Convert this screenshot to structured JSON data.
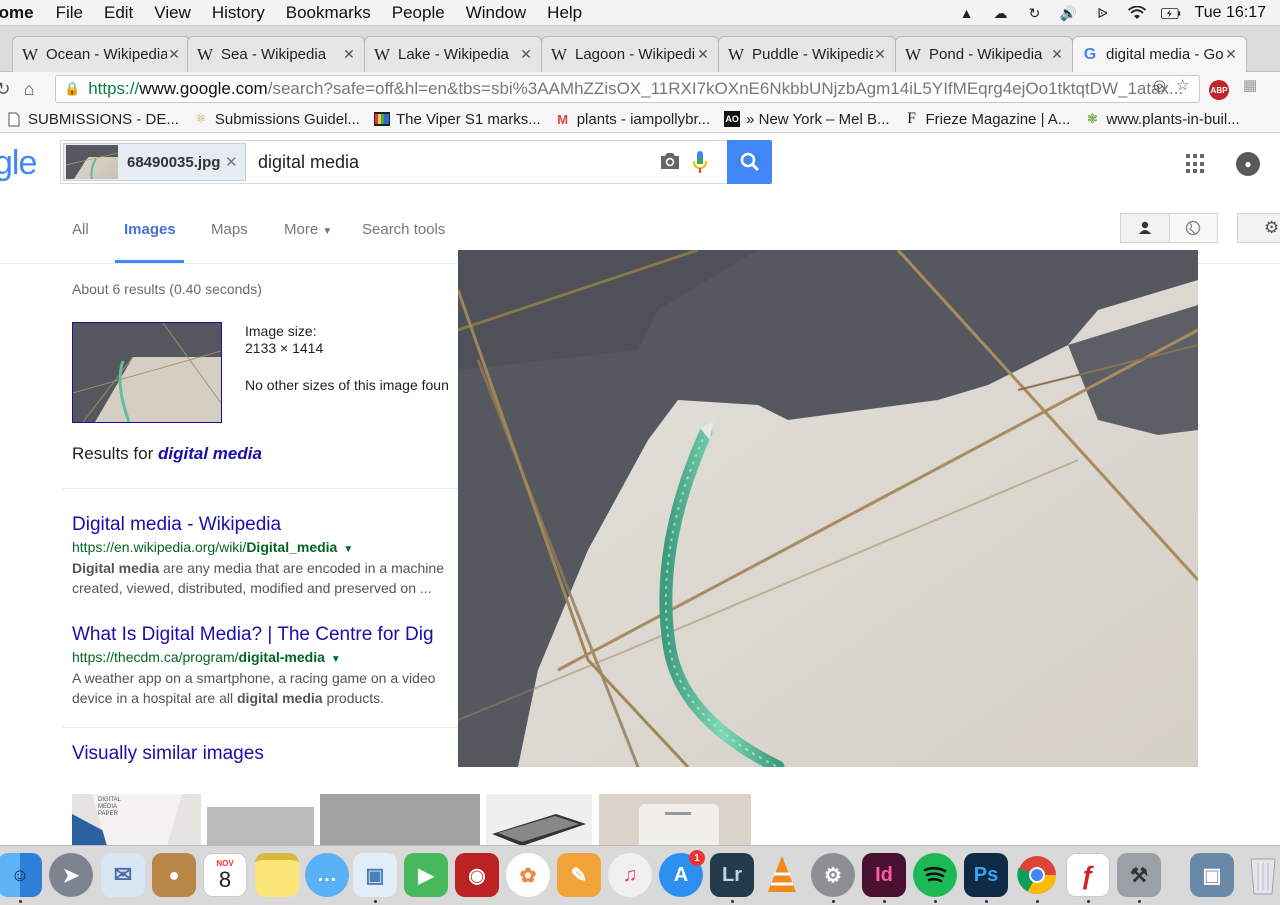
{
  "menubar": {
    "app_name": "rome",
    "menus": [
      "File",
      "Edit",
      "View",
      "History",
      "Bookmarks",
      "People",
      "Window",
      "Help"
    ],
    "clock": "Tue 16:17"
  },
  "tabs": [
    {
      "label": "Ocean - Wikipedia",
      "favicon": "W"
    },
    {
      "label": "Sea - Wikipedia",
      "favicon": "W"
    },
    {
      "label": "Lake - Wikipedia",
      "favicon": "W"
    },
    {
      "label": "Lagoon - Wikipedia",
      "favicon": "W"
    },
    {
      "label": "Puddle - Wikipedia",
      "favicon": "W"
    },
    {
      "label": "Pond - Wikipedia",
      "favicon": "W"
    },
    {
      "label": "digital media - Google",
      "favicon": "G"
    }
  ],
  "omnibox": {
    "scheme": "https://",
    "host": "www.google.com",
    "rest": "/search?safe=off&hl=en&tbs=sbi%3AAMhZZisOX_11RXI7kOXnE6NkbbUNjzbAgm14iL5YIfMEqrg4ejOo1tktqtDW_1atax..."
  },
  "bookmarks": [
    {
      "label": "SUBMISSIONS - DE...",
      "icon": "page-icon"
    },
    {
      "label": "Submissions Guidel...",
      "icon": "submittable-icon"
    },
    {
      "label": "The Viper S1 marks...",
      "icon": "viper-icon"
    },
    {
      "label": "plants - iampollybr...",
      "icon": "gmail-icon"
    },
    {
      "label": "» New York – Mel B...",
      "icon": "ao-icon"
    },
    {
      "label": "Frieze Magazine | A...",
      "icon": "frieze-icon"
    },
    {
      "label": "www.plants-in-buil...",
      "icon": "plant-icon"
    }
  ],
  "search": {
    "logo_fragment": "gle",
    "image_chip": "68490035.jpg",
    "query": "digital media"
  },
  "nav": {
    "tabs": [
      "All",
      "Images",
      "Maps",
      "More",
      "Search tools"
    ],
    "active": "Images"
  },
  "results": {
    "stats": "About 6 results (0.40 seconds)",
    "image_size_label": "Image size:",
    "image_size_value": "2133 × 1414",
    "no_other_sizes": "No other sizes of this image foun",
    "results_for_prefix": "Results for ",
    "results_for_query": "digital media",
    "items": [
      {
        "title": "Digital media - Wikipedia",
        "url_prefix": "https://en.wikipedia.org/wiki/",
        "url_bold": "Digital_media",
        "snippet_line1_bold": "Digital media",
        "snippet_line1_rest": " are any media that are encoded in a machine",
        "snippet_line2": "created, viewed, distributed, modified and preserved on ..."
      },
      {
        "title": "What Is Digital Media? | The Centre for Dig",
        "url_prefix": "https://thecdm.ca/program/",
        "url_bold": "digital-media",
        "snippet_line1": "A weather app on a smartphone, a racing game on a video",
        "snippet_line2_pre": "device in a hospital are all ",
        "snippet_line2_bold": "digital media",
        "snippet_line2_post": " products."
      }
    ],
    "visually_similar": "Visually similar images"
  },
  "similar_thumb_text": "DIGITAL MEDIA PAPER",
  "dock": {
    "calendar_month": "NOV",
    "calendar_day": "8",
    "appstore_badge": "1",
    "apps": [
      "finder-icon",
      "launchpad-icon",
      "mail-icon",
      "contacts-icon",
      "calendar-icon",
      "notes-icon",
      "messages-icon",
      "preview-icon",
      "facetime-icon",
      "photobooth-icon",
      "photos-icon",
      "pages-icon",
      "itunes-icon",
      "appstore-icon",
      "lightroom-icon",
      "vlc-icon",
      "system-preferences-icon",
      "indesign-icon",
      "spotify-icon",
      "photoshop-icon",
      "chrome-icon",
      "acrobat-icon",
      "utility-icon",
      "image-capture-icon",
      "trash-icon"
    ],
    "lightroom_label": "Lr",
    "indesign_label": "Id",
    "photoshop_label": "Ps"
  },
  "colors": {
    "link": "#1a0dab",
    "url_green": "#006621",
    "google_blue": "#4285f4"
  }
}
